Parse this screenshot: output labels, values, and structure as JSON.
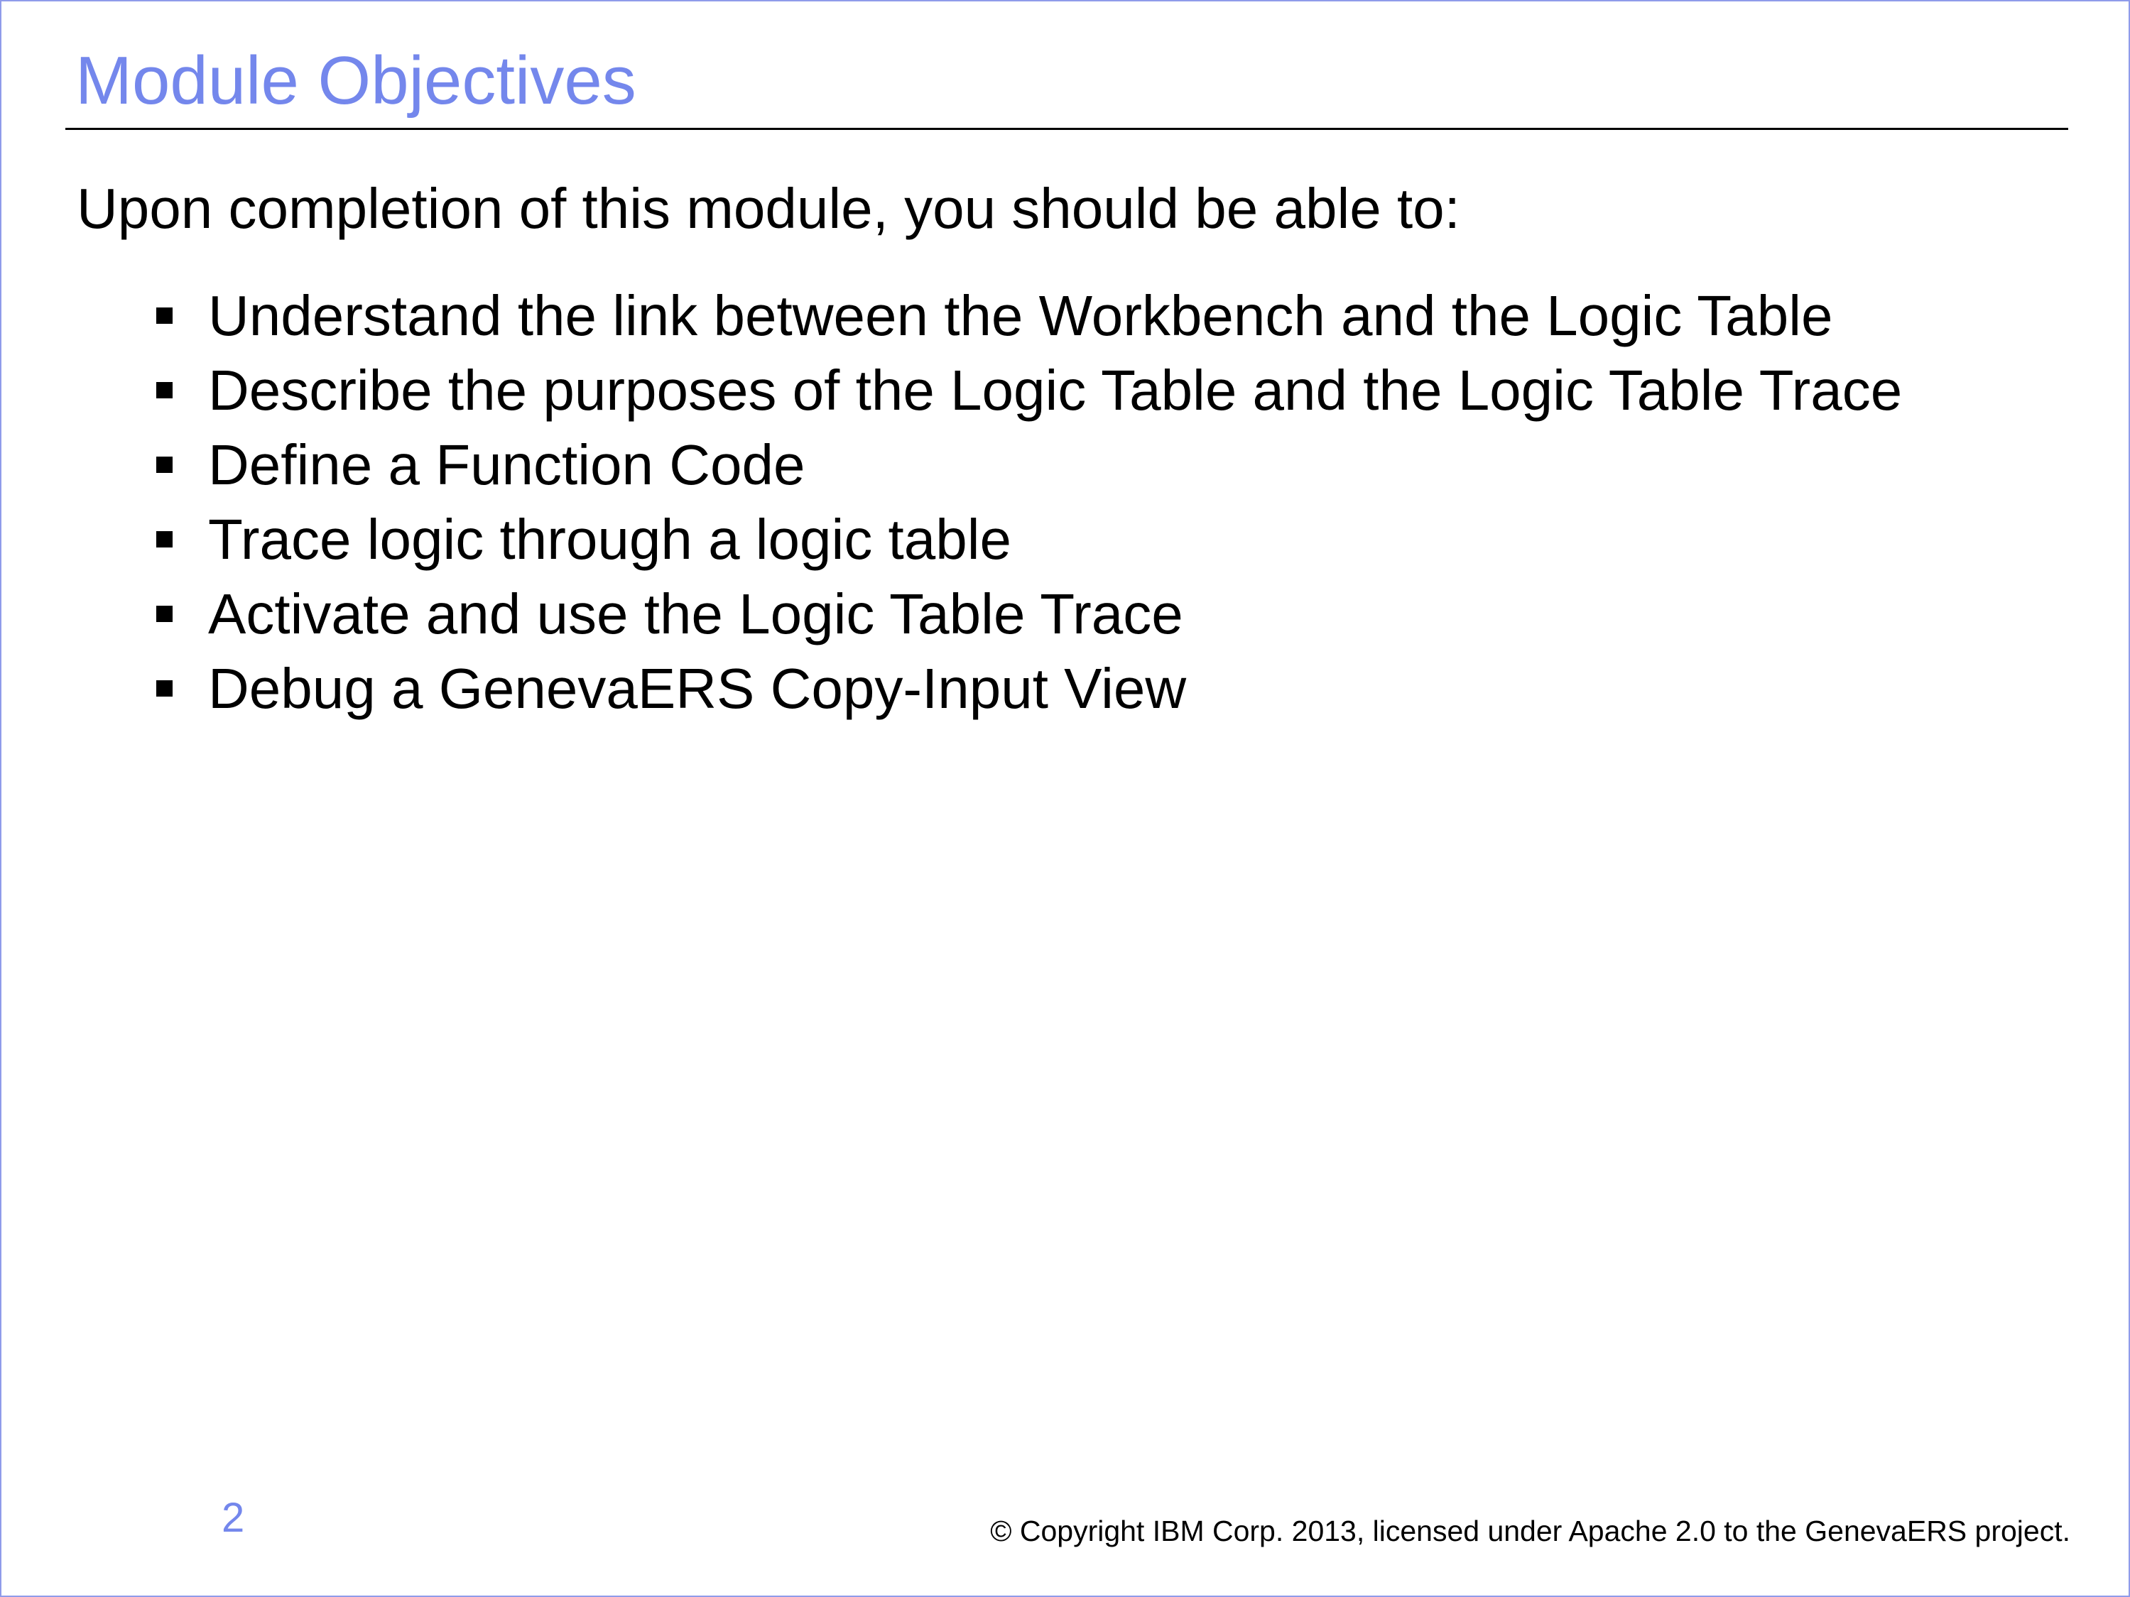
{
  "slide": {
    "title": "Module Objectives",
    "intro": "Upon completion of this module, you should be able to:",
    "objectives": [
      "Understand the link between the Workbench and the Logic Table",
      "Describe the purposes of the Logic Table and the Logic Table Trace",
      "Define a Function Code",
      "Trace logic through a logic table",
      "Activate and use the Logic Table Trace",
      "Debug a GenevaERS Copy-Input View"
    ],
    "page_number": "2",
    "copyright": "© Copyright IBM Corp. 2013, licensed under Apache 2.0 to the GenevaERS project."
  },
  "colors": {
    "title": "#7487ec",
    "border": "#8f9bea",
    "text": "#000000",
    "background": "#ffffff"
  },
  "icons": {
    "bullet": "square-bullet-icon"
  }
}
